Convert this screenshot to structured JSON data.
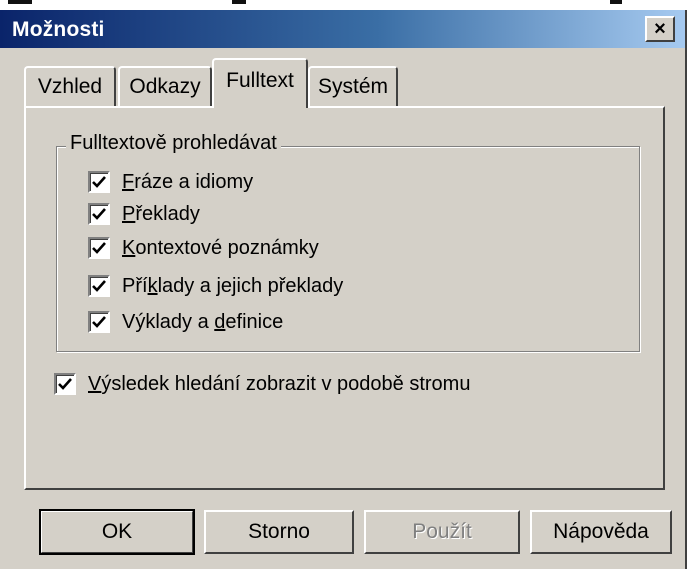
{
  "dialog": {
    "title": "Možnosti",
    "close_label": "×"
  },
  "tabs": [
    {
      "label": "Vzhled",
      "active": false
    },
    {
      "label": "Odkazy",
      "active": false
    },
    {
      "label": "Fulltext",
      "active": true
    },
    {
      "label": "Systém",
      "active": false
    }
  ],
  "fulltext_group": {
    "legend": "Fulltextově prohledávat",
    "options": [
      {
        "label_pre": "",
        "label_key": "F",
        "label_post": "ráze a idiomy",
        "checked": true
      },
      {
        "label_pre": "",
        "label_key": "P",
        "label_post": "řeklady",
        "checked": true
      },
      {
        "label_pre": "",
        "label_key": "K",
        "label_post": "ontextové poznámky",
        "checked": true
      },
      {
        "label_pre": "Pří",
        "label_key": "k",
        "label_post": "lady a jejich překlady",
        "checked": true
      },
      {
        "label_pre": "Výklady a ",
        "label_key": "d",
        "label_post": "efinice",
        "checked": true
      }
    ]
  },
  "tree_option": {
    "label_pre": "",
    "label_key": "V",
    "label_post": "ýsledek hledání zobrazit v podobě stromu",
    "checked": true
  },
  "buttons": {
    "ok": "OK",
    "cancel": "Storno",
    "apply": "Použít",
    "help": "Nápověda"
  }
}
